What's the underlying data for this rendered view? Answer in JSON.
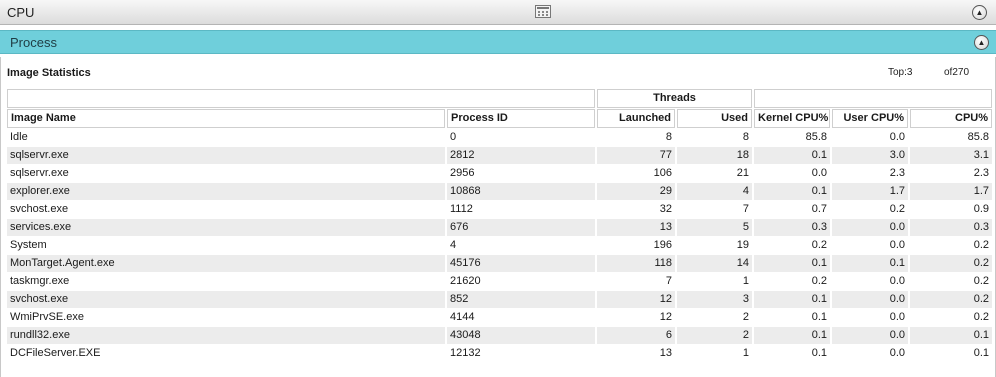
{
  "cpu_section": {
    "title": "CPU"
  },
  "process_section": {
    "title": "Process"
  },
  "image_statistics": {
    "title": "Image Statistics",
    "top_label": "Top:",
    "top_value": "3",
    "of_label": "of",
    "of_value": "270",
    "group_header": "Threads",
    "columns": [
      "Image Name",
      "Process ID",
      "Launched",
      "Used",
      "Kernel CPU%",
      "User CPU%",
      "CPU%"
    ],
    "rows": [
      [
        "Idle",
        "0",
        "8",
        "8",
        "85.8",
        "0.0",
        "85.8"
      ],
      [
        "sqlservr.exe",
        "2812",
        "77",
        "18",
        "0.1",
        "3.0",
        "3.1"
      ],
      [
        "sqlservr.exe",
        "2956",
        "106",
        "21",
        "0.0",
        "2.3",
        "2.3"
      ],
      [
        "explorer.exe",
        "10868",
        "29",
        "4",
        "0.1",
        "1.7",
        "1.7"
      ],
      [
        "svchost.exe",
        "1112",
        "32",
        "7",
        "0.7",
        "0.2",
        "0.9"
      ],
      [
        "services.exe",
        "676",
        "13",
        "5",
        "0.3",
        "0.0",
        "0.3"
      ],
      [
        "System",
        "4",
        "196",
        "19",
        "0.2",
        "0.0",
        "0.2"
      ],
      [
        "MonTarget.Agent.exe",
        "45176",
        "118",
        "14",
        "0.1",
        "0.1",
        "0.2"
      ],
      [
        "taskmgr.exe",
        "21620",
        "7",
        "1",
        "0.2",
        "0.0",
        "0.2"
      ],
      [
        "svchost.exe",
        "852",
        "12",
        "3",
        "0.1",
        "0.0",
        "0.2"
      ],
      [
        "WmiPrvSE.exe",
        "4144",
        "12",
        "2",
        "0.1",
        "0.0",
        "0.2"
      ],
      [
        "rundll32.exe",
        "43048",
        "6",
        "2",
        "0.1",
        "0.0",
        "0.1"
      ],
      [
        "DCFileServer.EXE",
        "12132",
        "13",
        "1",
        "0.1",
        "0.0",
        "0.1"
      ]
    ]
  }
}
